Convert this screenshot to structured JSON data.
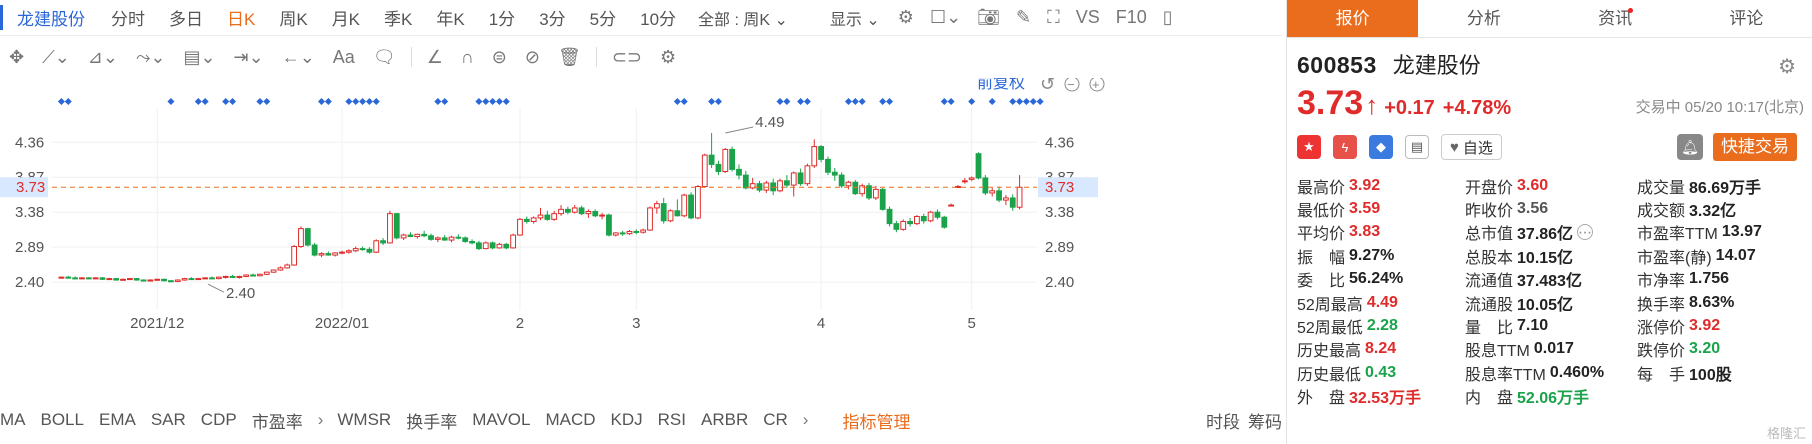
{
  "toolbar": {
    "stock_name": "龙建股份",
    "periods": [
      "分时",
      "多日",
      "日K",
      "周K",
      "月K",
      "季K",
      "年K",
      "1分",
      "3分",
      "5分",
      "10分"
    ],
    "active_period": "日K",
    "range_select": "全部 : 周K",
    "display_select": "显示",
    "vs_label": "VS",
    "f10_label": "F10"
  },
  "chart_toolbar": {
    "text_tool": "Aa"
  },
  "chart_data": {
    "type": "candlestick",
    "adjust_label": "前复权",
    "y_ticks": [
      4.36,
      3.87,
      3.38,
      2.89,
      2.4
    ],
    "ylim": [
      2.15,
      4.7
    ],
    "current_price": 3.73,
    "current_price_label": "3.73",
    "x_labels": [
      {
        "label": "2021/12",
        "index": 14
      },
      {
        "label": "2022/01",
        "index": 41
      },
      {
        "label": "2",
        "index": 67
      },
      {
        "label": "3",
        "index": 84
      },
      {
        "label": "4",
        "index": 111
      },
      {
        "label": "5",
        "index": 133
      }
    ],
    "annotations": [
      {
        "label": "4.49",
        "index": 97,
        "value": 4.49
      },
      {
        "label": "2.40",
        "index": 22,
        "value": 2.4
      }
    ],
    "marker_indices": [
      0,
      1,
      16,
      20,
      21,
      24,
      25,
      29,
      30,
      38,
      39,
      42,
      43,
      44,
      45,
      46,
      55,
      56,
      61,
      62,
      63,
      64,
      65,
      90,
      91,
      95,
      96,
      105,
      106,
      108,
      109,
      115,
      116,
      117,
      120,
      121,
      129,
      130,
      133,
      136,
      139,
      140,
      141,
      142,
      143
    ],
    "candles": [
      [
        2.46,
        2.48,
        2.45,
        2.47
      ],
      [
        2.47,
        2.49,
        2.45,
        2.46
      ],
      [
        2.46,
        2.48,
        2.44,
        2.45
      ],
      [
        2.45,
        2.47,
        2.44,
        2.46
      ],
      [
        2.46,
        2.47,
        2.44,
        2.45
      ],
      [
        2.45,
        2.47,
        2.44,
        2.46
      ],
      [
        2.46,
        2.47,
        2.43,
        2.44
      ],
      [
        2.44,
        2.46,
        2.43,
        2.45
      ],
      [
        2.45,
        2.46,
        2.42,
        2.43
      ],
      [
        2.43,
        2.45,
        2.42,
        2.44
      ],
      [
        2.44,
        2.46,
        2.43,
        2.45
      ],
      [
        2.45,
        2.46,
        2.42,
        2.43
      ],
      [
        2.43,
        2.44,
        2.41,
        2.42
      ],
      [
        2.42,
        2.44,
        2.41,
        2.43
      ],
      [
        2.43,
        2.45,
        2.42,
        2.44
      ],
      [
        2.44,
        2.45,
        2.41,
        2.42
      ],
      [
        2.42,
        2.43,
        2.4,
        2.41
      ],
      [
        2.41,
        2.44,
        2.4,
        2.43
      ],
      [
        2.43,
        2.46,
        2.42,
        2.45
      ],
      [
        2.45,
        2.47,
        2.43,
        2.44
      ],
      [
        2.44,
        2.46,
        2.43,
        2.45
      ],
      [
        2.45,
        2.47,
        2.44,
        2.46
      ],
      [
        2.46,
        2.48,
        2.44,
        2.45
      ],
      [
        2.45,
        2.48,
        2.44,
        2.47
      ],
      [
        2.47,
        2.49,
        2.45,
        2.48
      ],
      [
        2.48,
        2.5,
        2.46,
        2.47
      ],
      [
        2.47,
        2.49,
        2.45,
        2.48
      ],
      [
        2.48,
        2.51,
        2.47,
        2.5
      ],
      [
        2.5,
        2.52,
        2.48,
        2.49
      ],
      [
        2.49,
        2.52,
        2.48,
        2.51
      ],
      [
        2.51,
        2.55,
        2.5,
        2.54
      ],
      [
        2.54,
        2.58,
        2.53,
        2.57
      ],
      [
        2.57,
        2.62,
        2.56,
        2.6
      ],
      [
        2.6,
        2.66,
        2.59,
        2.64
      ],
      [
        2.64,
        2.92,
        2.63,
        2.9
      ],
      [
        2.9,
        3.18,
        2.88,
        3.15
      ],
      [
        3.15,
        3.16,
        2.9,
        2.92
      ],
      [
        2.92,
        2.95,
        2.76,
        2.78
      ],
      [
        2.78,
        2.82,
        2.75,
        2.8
      ],
      [
        2.8,
        2.83,
        2.77,
        2.78
      ],
      [
        2.78,
        2.82,
        2.76,
        2.81
      ],
      [
        2.81,
        2.84,
        2.79,
        2.82
      ],
      [
        2.82,
        2.86,
        2.8,
        2.84
      ],
      [
        2.84,
        2.9,
        2.82,
        2.87
      ],
      [
        2.87,
        2.9,
        2.84,
        2.86
      ],
      [
        2.86,
        2.89,
        2.8,
        2.82
      ],
      [
        2.82,
        3.0,
        2.81,
        2.98
      ],
      [
        2.98,
        3.02,
        2.92,
        2.95
      ],
      [
        2.95,
        3.4,
        2.94,
        3.36
      ],
      [
        3.36,
        3.37,
        3.0,
        3.02
      ],
      [
        3.02,
        3.08,
        2.99,
        3.06
      ],
      [
        3.06,
        3.1,
        3.03,
        3.04
      ],
      [
        3.04,
        3.08,
        3.01,
        3.07
      ],
      [
        3.07,
        3.12,
        3.03,
        3.05
      ],
      [
        3.05,
        3.08,
        2.98,
        3.0
      ],
      [
        3.0,
        3.04,
        2.96,
        3.02
      ],
      [
        3.02,
        3.06,
        2.98,
        2.99
      ],
      [
        2.99,
        3.05,
        2.96,
        3.03
      ],
      [
        3.03,
        3.07,
        3.0,
        3.02
      ],
      [
        3.02,
        3.04,
        2.95,
        2.97
      ],
      [
        2.97,
        3.0,
        2.93,
        2.95
      ],
      [
        2.95,
        2.98,
        2.85,
        2.87
      ],
      [
        2.87,
        2.97,
        2.86,
        2.95
      ],
      [
        2.95,
        2.97,
        2.86,
        2.88
      ],
      [
        2.88,
        2.95,
        2.87,
        2.93
      ],
      [
        2.93,
        2.95,
        2.86,
        2.88
      ],
      [
        2.88,
        3.08,
        2.87,
        3.06
      ],
      [
        3.06,
        3.3,
        3.05,
        3.28
      ],
      [
        3.28,
        3.32,
        3.22,
        3.25
      ],
      [
        3.25,
        3.32,
        3.22,
        3.3
      ],
      [
        3.3,
        3.44,
        3.27,
        3.34
      ],
      [
        3.34,
        3.4,
        3.26,
        3.28
      ],
      [
        3.28,
        3.4,
        3.26,
        3.36
      ],
      [
        3.36,
        3.48,
        3.33,
        3.42
      ],
      [
        3.42,
        3.46,
        3.35,
        3.38
      ],
      [
        3.38,
        3.48,
        3.36,
        3.44
      ],
      [
        3.44,
        3.47,
        3.34,
        3.36
      ],
      [
        3.36,
        3.42,
        3.3,
        3.39
      ],
      [
        3.39,
        3.42,
        3.31,
        3.33
      ],
      [
        3.33,
        3.37,
        3.28,
        3.34
      ],
      [
        3.34,
        3.36,
        3.04,
        3.06
      ],
      [
        3.06,
        3.1,
        3.04,
        3.09
      ],
      [
        3.09,
        3.12,
        3.05,
        3.08
      ],
      [
        3.08,
        3.13,
        3.06,
        3.11
      ],
      [
        3.11,
        3.14,
        3.07,
        3.1
      ],
      [
        3.1,
        3.15,
        3.08,
        3.13
      ],
      [
        3.13,
        3.46,
        3.12,
        3.44
      ],
      [
        3.44,
        3.54,
        3.36,
        3.5
      ],
      [
        3.5,
        3.58,
        3.22,
        3.26
      ],
      [
        3.26,
        3.42,
        3.24,
        3.4
      ],
      [
        3.4,
        3.56,
        3.32,
        3.33
      ],
      [
        3.33,
        3.64,
        3.31,
        3.62
      ],
      [
        3.62,
        3.66,
        3.28,
        3.3
      ],
      [
        3.3,
        3.76,
        3.28,
        3.74
      ],
      [
        3.74,
        4.2,
        3.72,
        4.18
      ],
      [
        4.18,
        4.49,
        4.0,
        4.05
      ],
      [
        4.05,
        4.1,
        3.9,
        3.95
      ],
      [
        3.95,
        4.28,
        3.93,
        4.26
      ],
      [
        4.26,
        4.3,
        3.95,
        3.98
      ],
      [
        3.98,
        4.05,
        3.84,
        3.9
      ],
      [
        3.9,
        3.96,
        3.7,
        3.72
      ],
      [
        3.72,
        3.86,
        3.7,
        3.78
      ],
      [
        3.78,
        3.82,
        3.66,
        3.69
      ],
      [
        3.69,
        3.82,
        3.65,
        3.79
      ],
      [
        3.79,
        3.85,
        3.62,
        3.68
      ],
      [
        3.68,
        3.85,
        3.66,
        3.82
      ],
      [
        3.82,
        3.9,
        3.72,
        3.76
      ],
      [
        3.76,
        3.95,
        3.6,
        3.93
      ],
      [
        3.93,
        3.99,
        3.75,
        3.78
      ],
      [
        3.78,
        4.06,
        3.75,
        4.03
      ],
      [
        4.03,
        4.4,
        4.0,
        4.3
      ],
      [
        4.3,
        4.32,
        4.08,
        4.12
      ],
      [
        4.12,
        4.16,
        3.9,
        3.94
      ],
      [
        3.94,
        4.0,
        3.82,
        3.9
      ],
      [
        3.9,
        3.94,
        3.72,
        3.75
      ],
      [
        3.75,
        3.82,
        3.7,
        3.8
      ],
      [
        3.8,
        3.83,
        3.62,
        3.64
      ],
      [
        3.64,
        3.78,
        3.6,
        3.75
      ],
      [
        3.75,
        3.79,
        3.55,
        3.58
      ],
      [
        3.58,
        3.75,
        3.55,
        3.7
      ],
      [
        3.7,
        3.72,
        3.4,
        3.42
      ],
      [
        3.42,
        3.46,
        3.18,
        3.22
      ],
      [
        3.22,
        3.26,
        3.1,
        3.14
      ],
      [
        3.14,
        3.28,
        3.12,
        3.25
      ],
      [
        3.25,
        3.3,
        3.18,
        3.22
      ],
      [
        3.22,
        3.34,
        3.2,
        3.32
      ],
      [
        3.32,
        3.36,
        3.22,
        3.26
      ],
      [
        3.26,
        3.4,
        3.24,
        3.38
      ],
      [
        3.38,
        3.42,
        3.28,
        3.31
      ],
      [
        3.31,
        3.33,
        3.15,
        3.17
      ],
      [
        3.48,
        3.5,
        3.46,
        3.48
      ],
      [
        3.74,
        3.76,
        3.72,
        3.74
      ],
      [
        3.82,
        3.86,
        3.78,
        3.82
      ],
      [
        3.84,
        3.88,
        3.82,
        3.86
      ],
      [
        4.2,
        4.22,
        3.84,
        3.86
      ],
      [
        3.86,
        3.9,
        3.62,
        3.65
      ],
      [
        3.65,
        3.72,
        3.6,
        3.68
      ],
      [
        3.68,
        3.74,
        3.52,
        3.55
      ],
      [
        3.55,
        3.62,
        3.48,
        3.58
      ],
      [
        3.58,
        3.63,
        3.4,
        3.45
      ],
      [
        3.45,
        3.9,
        3.42,
        3.73
      ]
    ]
  },
  "indicators": [
    "MA",
    "BOLL",
    "EMA",
    "SAR",
    "CDP",
    "市盈率",
    "WMSR",
    "换手率",
    "MAVOL",
    "MACD",
    "KDJ",
    "RSI",
    "ARBR",
    "CR"
  ],
  "indicator_manager": "指标管理",
  "bottom_right": [
    "时段",
    "筹码"
  ],
  "panel": {
    "tabs": [
      "报价",
      "分析",
      "资讯",
      "评论"
    ],
    "code": "600853",
    "name": "龙建股份",
    "price": "3.73",
    "change": "+0.17",
    "change_pct": "+4.78%",
    "trade_time": "交易中 05/20 10:17(北京)",
    "watch_label": "自选",
    "quick_trade": "快捷交易",
    "stats": [
      {
        "label": "最高价",
        "value": "3.92",
        "color": "red"
      },
      {
        "label": "开盘价",
        "value": "3.60",
        "color": "red"
      },
      {
        "label": "成交量",
        "value": "86.69万手",
        "color": "black"
      },
      {
        "label": "最低价",
        "value": "3.59",
        "color": "red"
      },
      {
        "label": "昨收价",
        "value": "3.56",
        "color": "gray"
      },
      {
        "label": "成交额",
        "value": "3.32亿",
        "color": "black"
      },
      {
        "label": "平均价",
        "value": "3.83",
        "color": "red"
      },
      {
        "label": "总市值",
        "value": "37.86亿",
        "color": "black"
      },
      {
        "label": "市盈率TTM",
        "value": "13.97",
        "color": "black"
      },
      {
        "label": "振　幅",
        "value": "9.27%",
        "color": "black"
      },
      {
        "label": "总股本",
        "value": "10.15亿",
        "color": "black"
      },
      {
        "label": "市盈率(静)",
        "value": "14.07",
        "color": "black"
      },
      {
        "label": "委　比",
        "value": "56.24%",
        "color": "black"
      },
      {
        "label": "流通值",
        "value": "37.483亿",
        "color": "black"
      },
      {
        "label": "市净率",
        "value": "1.756",
        "color": "black"
      },
      {
        "label": "52周最高",
        "value": "4.49",
        "color": "red"
      },
      {
        "label": "流通股",
        "value": "10.05亿",
        "color": "black"
      },
      {
        "label": "换手率",
        "value": "8.63%",
        "color": "black"
      },
      {
        "label": "52周最低",
        "value": "2.28",
        "color": "green"
      },
      {
        "label": "量　比",
        "value": "7.10",
        "color": "black"
      },
      {
        "label": "涨停价",
        "value": "3.92",
        "color": "red"
      },
      {
        "label": "历史最高",
        "value": "8.24",
        "color": "red"
      },
      {
        "label": "股息TTM",
        "value": "0.017",
        "color": "black"
      },
      {
        "label": "跌停价",
        "value": "3.20",
        "color": "green"
      },
      {
        "label": "历史最低",
        "value": "0.43",
        "color": "green"
      },
      {
        "label": "股息率TTM",
        "value": "0.460%",
        "color": "black"
      },
      {
        "label": "每　手",
        "value": "100股",
        "color": "black"
      },
      {
        "label": "外　盘",
        "value": "32.53万手",
        "color": "red"
      },
      {
        "label": "内　盘",
        "value": "52.06万手",
        "color": "green"
      }
    ],
    "watermark": "格隆汇"
  },
  "colors": {
    "accent": "#ea6c1d",
    "up": "#e02b2b",
    "down": "#1aa34a",
    "link": "#2a67d8",
    "marker": "#2a67d8"
  }
}
